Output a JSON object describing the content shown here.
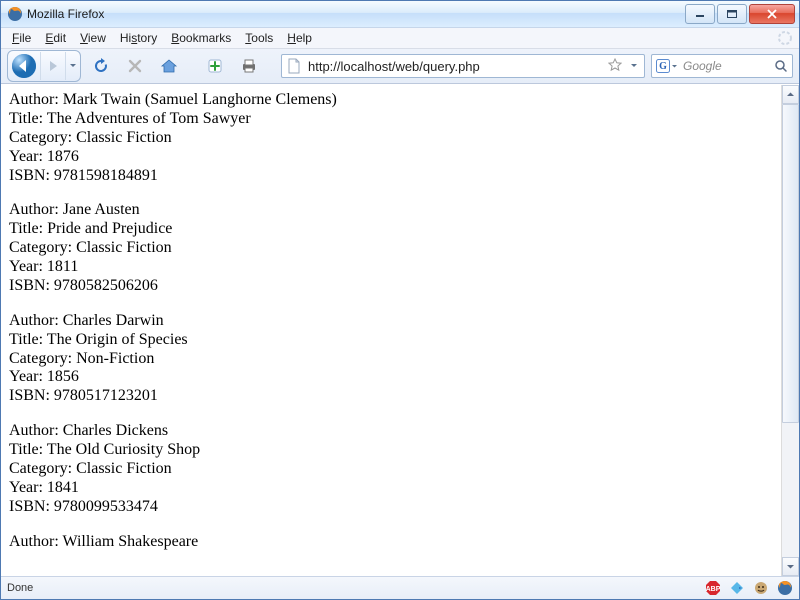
{
  "window": {
    "title": "Mozilla Firefox"
  },
  "menu": {
    "file": "File",
    "edit": "Edit",
    "view": "View",
    "history": "History",
    "bookmarks": "Bookmarks",
    "tools": "Tools",
    "help": "Help"
  },
  "nav": {
    "url": "http://localhost/web/query.php",
    "search_placeholder": "Google",
    "search_engine_label": "G"
  },
  "status": {
    "text": "Done"
  },
  "books": [
    {
      "author": "Mark Twain (Samuel Langhorne Clemens)",
      "title": "The Adventures of Tom Sawyer",
      "category": "Classic Fiction",
      "year": "1876",
      "isbn": "9781598184891"
    },
    {
      "author": "Jane Austen",
      "title": "Pride and Prejudice",
      "category": "Classic Fiction",
      "year": "1811",
      "isbn": "9780582506206"
    },
    {
      "author": "Charles Darwin",
      "title": "The Origin of Species",
      "category": "Non-Fiction",
      "year": "1856",
      "isbn": "9780517123201"
    },
    {
      "author": "Charles Dickens",
      "title": "The Old Curiosity Shop",
      "category": "Classic Fiction",
      "year": "1841",
      "isbn": "9780099533474"
    },
    {
      "author": "William Shakespeare"
    }
  ],
  "labels": {
    "author": "Author: ",
    "title": "Title: ",
    "category": "Category: ",
    "year": "Year: ",
    "isbn": "ISBN: "
  }
}
